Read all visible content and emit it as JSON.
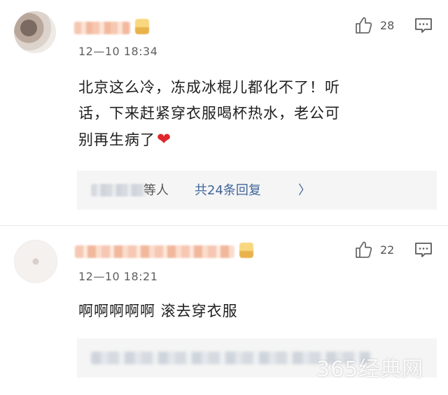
{
  "comments": [
    {
      "time": "12—10 18:34",
      "likes": "28",
      "text_line1": "北京这么冷，冻成冰棍儿都化不了！听",
      "text_line2": "话，下来赶紧穿衣服喝杯热水，老公可",
      "text_line3": "别再生病了",
      "heart": "❤",
      "reply_suffix": "等人",
      "reply_link": "共24条回复",
      "reply_chevron": "〉"
    },
    {
      "time": "12—10 18:21",
      "likes": "22",
      "text_line1": "啊啊啊啊啊 滚去穿衣服"
    }
  ],
  "watermark": "365经典网",
  "icons": {
    "like": "thumbs-up-icon",
    "reply": "comment-icon"
  },
  "colors": {
    "link": "#406599",
    "heart": "#e0262b"
  }
}
